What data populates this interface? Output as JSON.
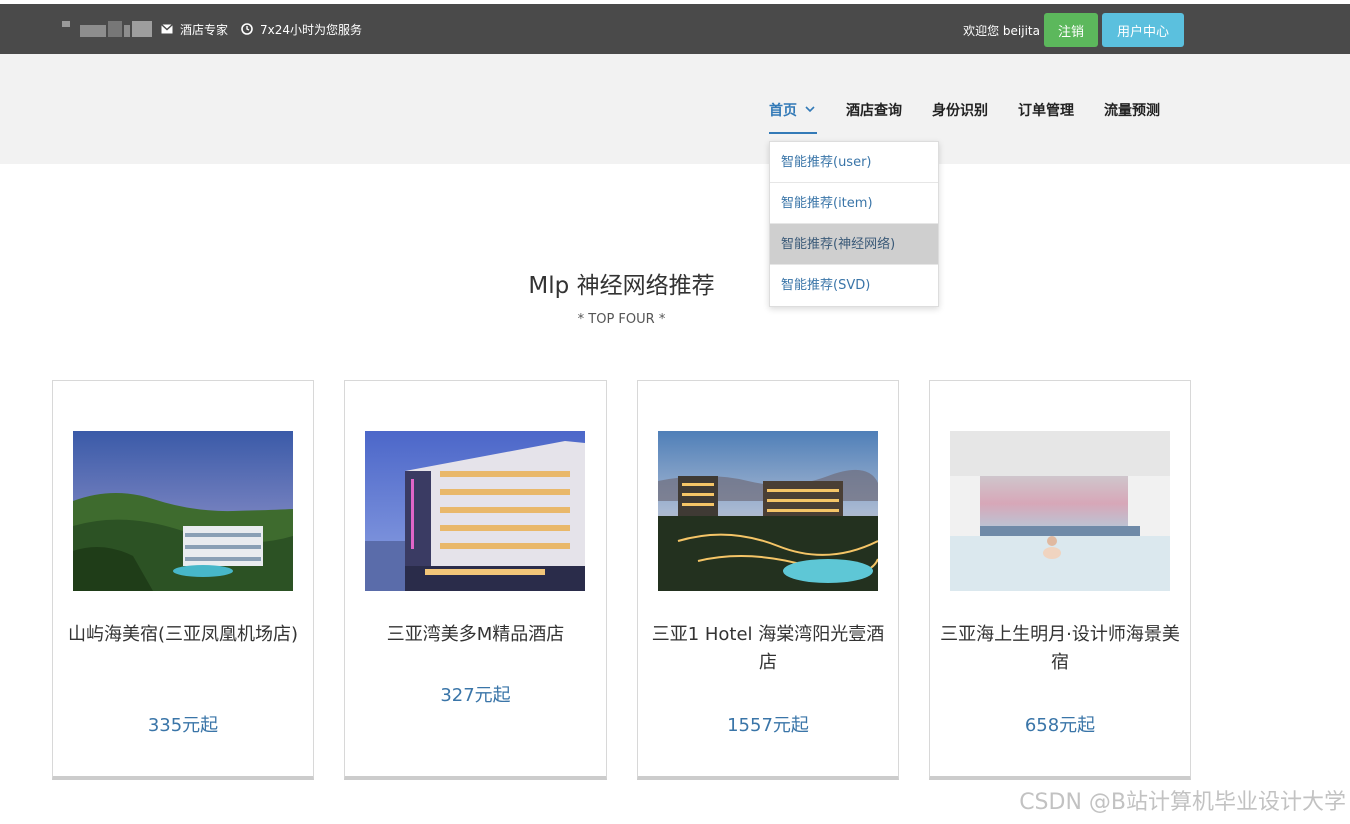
{
  "topbar": {
    "email_icon": "envelope-icon",
    "clock_icon": "clock-icon",
    "expert_text": "酒店专家",
    "service_text": "7x24小时为您服务",
    "welcome_text": "欢迎您 beijita",
    "logout_label": "注销",
    "user_center_label": "用户中心"
  },
  "nav": {
    "items": [
      {
        "label": "首页",
        "active": true
      },
      {
        "label": "酒店查询"
      },
      {
        "label": "身份识别"
      },
      {
        "label": "订单管理"
      },
      {
        "label": "流量预测"
      }
    ],
    "dropdown": [
      {
        "label": "智能推荐(user)"
      },
      {
        "label": "智能推荐(item)"
      },
      {
        "label": "智能推荐(神经网络)",
        "highlighted": true
      },
      {
        "label": "智能推荐(SVD)"
      }
    ]
  },
  "section": {
    "title": "Mlp 神经网络推荐",
    "subtitle": "* TOP FOUR *"
  },
  "hotels": [
    {
      "name": "山屿海美宿(三亚凤凰机场店)",
      "price": "335元起"
    },
    {
      "name": "三亚湾美多M精品酒店",
      "price": "327元起"
    },
    {
      "name": "三亚1 Hotel 海棠湾阳光壹酒店",
      "price": "1557元起"
    },
    {
      "name": "三亚海上生明月·设计师海景美宿",
      "price": "658元起"
    }
  ],
  "watermark": "CSDN @B站计算机毕业设计大学",
  "colors": {
    "topbar_bg": "#4a4a4a",
    "accent": "#337ab7",
    "logout_green": "#5cb85c",
    "user_center_blue": "#5bc0de",
    "price_blue": "#3a75a8"
  }
}
